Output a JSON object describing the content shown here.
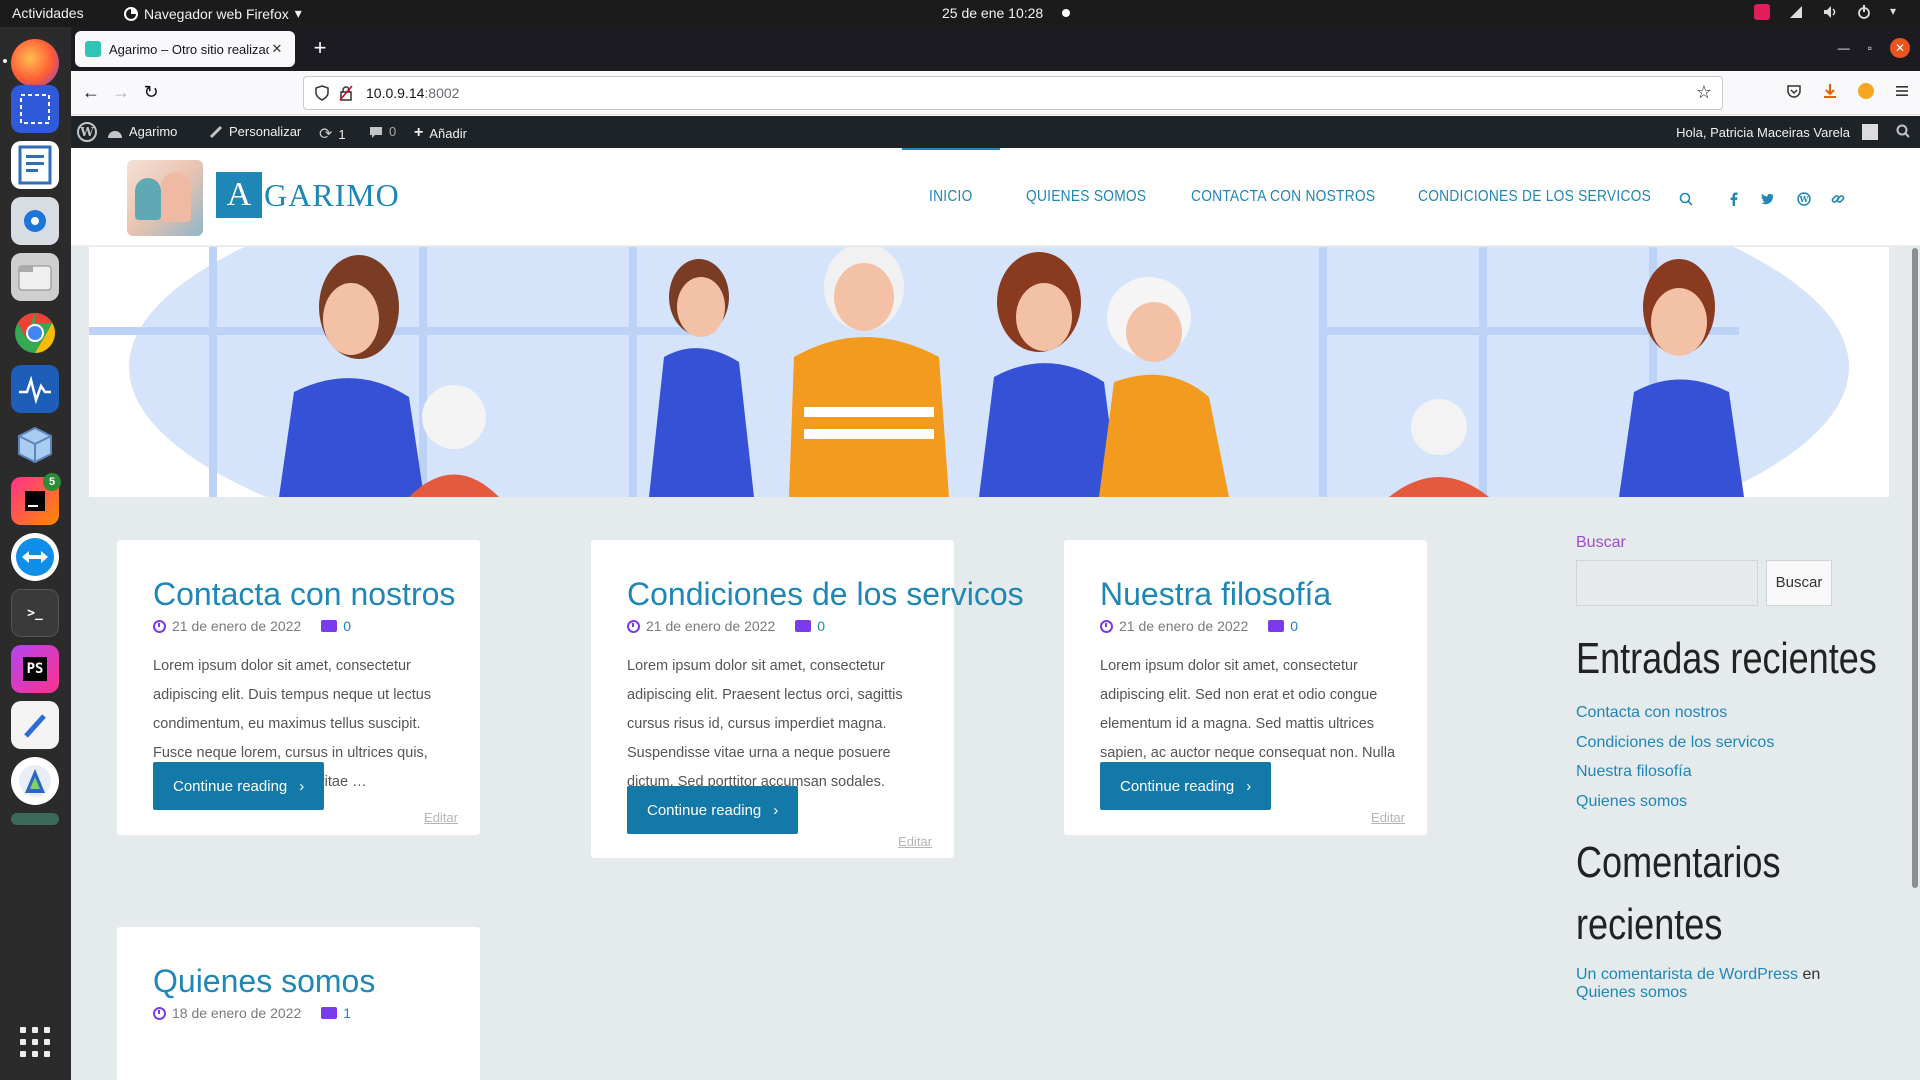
{
  "gnome": {
    "activities": "Actividades",
    "app_menu": "Navegador web Firefox",
    "clock": "25 de ene  10:28"
  },
  "dock": {
    "items": [
      {
        "name": "firefox-icon",
        "color": "#ff6a2b"
      },
      {
        "name": "screenshot-icon",
        "color": "#3b6fe3"
      },
      {
        "name": "document-viewer-icon",
        "color": "#2f6fb7"
      },
      {
        "name": "software-center-icon",
        "color": "#e2e6ea"
      },
      {
        "name": "files-icon",
        "color": "#d6d6d6"
      },
      {
        "name": "chrome-icon",
        "color": "#e8453c"
      },
      {
        "name": "system-monitor-icon",
        "color": "#2f76c7"
      },
      {
        "name": "virtualbox-icon",
        "color": "#9fc6ee"
      },
      {
        "name": "jetbrains-toolbox-icon",
        "color": "#e53a73"
      },
      {
        "name": "teamviewer-icon",
        "color": "#0e8ee9"
      },
      {
        "name": "terminal-icon",
        "color": "#3c3c3c"
      },
      {
        "name": "phpstorm-icon",
        "color": "#b345f1"
      },
      {
        "name": "text-editor-icon",
        "color": "#f2f2f2"
      },
      {
        "name": "android-studio-icon",
        "color": "#f5f5f5"
      }
    ],
    "badge": "5",
    "terminal_glyph": ">_",
    "phpstorm_glyph": "PS"
  },
  "browser": {
    "tab_title": "Agarimo – Otro sitio realizado con WordPress",
    "url_host": "10.0.9.14",
    "url_port": ":8002"
  },
  "wpbar": {
    "site": "Agarimo",
    "customize": "Personalizar",
    "updates": "1",
    "comments": "0",
    "new": "Añadir",
    "greeting": "Hola, Patricia Maceiras Varela"
  },
  "site": {
    "logo_initial": "A",
    "logo_rest": "GARIMO",
    "menu": [
      "INICIO",
      "QUIENES SOMOS",
      "CONTACTA CON NOSTROS",
      "CONDICIONES DE LOS SERVICOS"
    ]
  },
  "posts": [
    {
      "title": "Contacta con nostros",
      "date": "21 de enero de 2022",
      "comments": "0",
      "excerpt": "Lorem ipsum dolor sit amet, consectetur adipiscing elit. Duis tempus neque ut lectus condimentum, eu maximus tellus suscipit. Fusce neque lorem, cursus in ultrices quis, tempor id sapien. Nullam vitae …",
      "button": "Continue reading",
      "edit": "Editar"
    },
    {
      "title": "Condiciones de los servicos",
      "date": "21 de enero de 2022",
      "comments": "0",
      "excerpt": "Lorem ipsum dolor sit amet, consectetur adipiscing elit. Praesent lectus orci, sagittis cursus risus id, cursus imperdiet magna. Suspendisse vitae urna a neque posuere dictum. Sed porttitor accumsan sodales. Pellentesque …",
      "button": "Continue reading",
      "edit": "Editar"
    },
    {
      "title": "Nuestra filosofía",
      "date": "21 de enero de 2022",
      "comments": "0",
      "excerpt": "Lorem ipsum dolor sit amet, consectetur adipiscing elit. Sed non erat et odio congue elementum id a magna. Sed mattis ultrices sapien, ac auctor neque consequat non. Nulla dignissim arcu …",
      "button": "Continue reading",
      "edit": "Editar"
    },
    {
      "title": "Quienes somos",
      "date": "18 de enero de 2022",
      "comments": "1"
    }
  ],
  "sidebar": {
    "search_label": "Buscar",
    "search_button": "Buscar",
    "recent_posts_title": "Entradas recientes",
    "recent_posts": [
      "Contacta con nostros",
      "Condiciones de los servicos",
      "Nuestra filosofía",
      "Quienes somos"
    ],
    "recent_comments_title_1": "Comentarios",
    "recent_comments_title_2": "recientes",
    "comment_author": "Un comentarista de WordPress",
    "comment_on": "en",
    "comment_post": "Quienes somos"
  },
  "colors": {
    "accent": "#1e87b6",
    "button": "#1379a8",
    "meta_icon": "#7c3aed",
    "page_bg": "#e5eaec"
  }
}
